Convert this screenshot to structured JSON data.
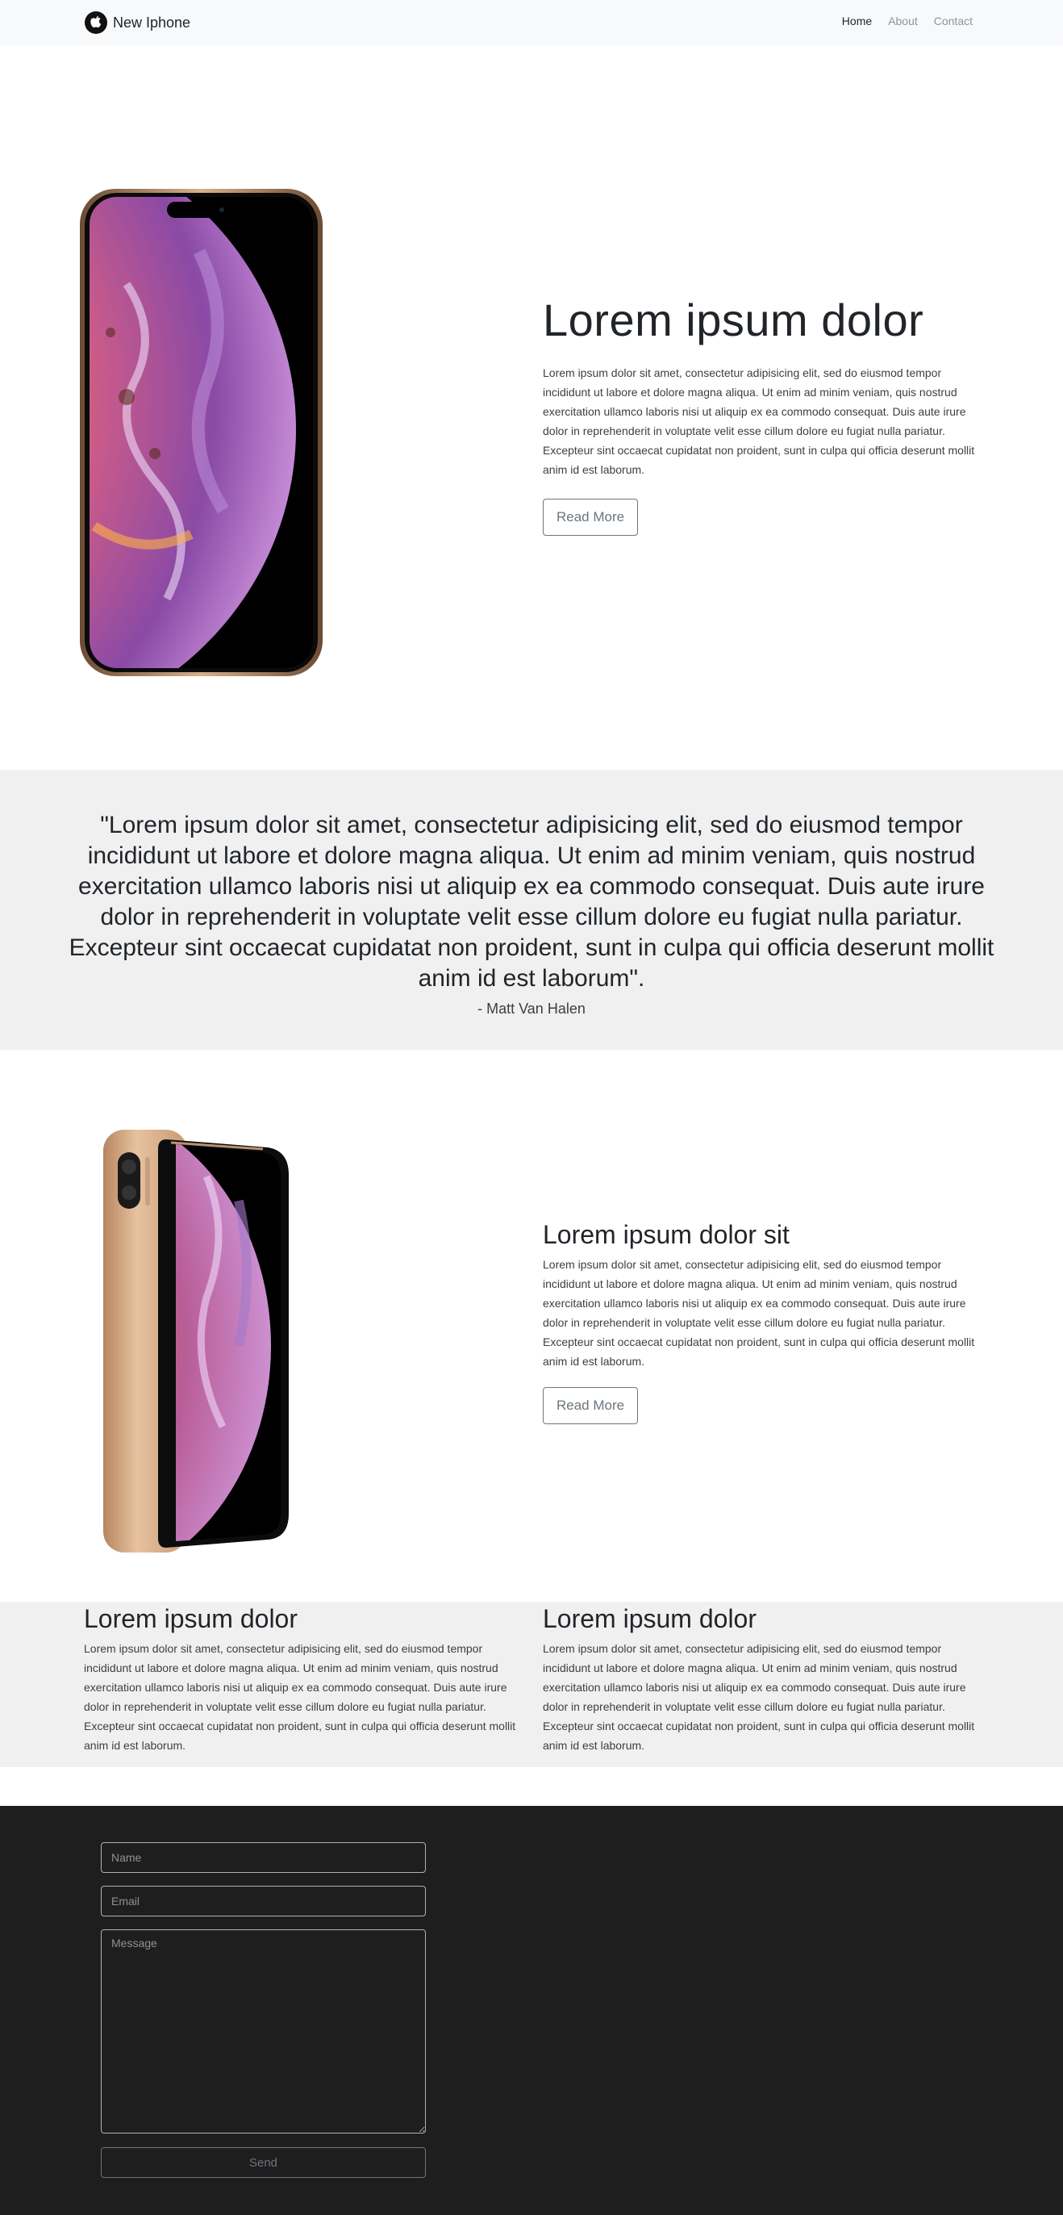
{
  "navbar": {
    "brand": "New Iphone",
    "brand_icon": "apple-logo-icon",
    "links": [
      "Home",
      "About",
      "Contact"
    ],
    "active": "Home"
  },
  "hero": {
    "title": "Lorem ipsum dolor",
    "body": "Lorem ipsum dolor sit amet, consectetur adipisicing elit, sed do eiusmod tempor incididunt ut labore et dolore magna aliqua. Ut enim ad minim veniam, quis nostrud exercitation ullamco laboris nisi ut aliquip ex ea commodo consequat. Duis aute irure dolor in reprehenderit in voluptate velit esse cillum dolore eu fugiat nulla pariatur. Excepteur sint occaecat cupidatat non proident, sunt in culpa qui officia deserunt mollit anim id est laborum.",
    "button": "Read More"
  },
  "quote": {
    "text": "\"Lorem ipsum dolor sit amet, consectetur adipisicing elit, sed do eiusmod tempor incididunt ut labore et dolore magna aliqua. Ut enim ad minim veniam, quis nostrud exercitation ullamco laboris nisi ut aliquip ex ea commodo consequat. Duis aute irure dolor in reprehenderit in voluptate velit esse cillum dolore eu fugiat nulla pariatur. Excepteur sint occaecat cupidatat non proident, sunt in culpa qui officia deserunt mollit anim id est laborum\".",
    "author": "- Matt Van Halen"
  },
  "section2": {
    "title": "Lorem ipsum dolor sit",
    "body": "Lorem ipsum dolor sit amet, consectetur adipisicing elit, sed do eiusmod tempor incididunt ut labore et dolore magna aliqua. Ut enim ad minim veniam, quis nostrud exercitation ullamco laboris nisi ut aliquip ex ea commodo consequat. Duis aute irure dolor in reprehenderit in voluptate velit esse cillum dolore eu fugiat nulla pariatur. Excepteur sint occaecat cupidatat non proident, sunt in culpa qui officia deserunt mollit anim id est laborum.",
    "button": "Read More"
  },
  "columns": [
    {
      "title": "Lorem ipsum dolor",
      "body": "Lorem ipsum dolor sit amet, consectetur adipisicing elit, sed do eiusmod tempor incididunt ut labore et dolore magna aliqua. Ut enim ad minim veniam, quis nostrud exercitation ullamco laboris nisi ut aliquip ex ea commodo consequat. Duis aute irure dolor in reprehenderit in voluptate velit esse cillum dolore eu fugiat nulla pariatur. Excepteur sint occaecat cupidatat non proident, sunt in culpa qui officia deserunt mollit anim id est laborum."
    },
    {
      "title": "Lorem ipsum dolor",
      "body": "Lorem ipsum dolor sit amet, consectetur adipisicing elit, sed do eiusmod tempor incididunt ut labore et dolore magna aliqua. Ut enim ad minim veniam, quis nostrud exercitation ullamco laboris nisi ut aliquip ex ea commodo consequat. Duis aute irure dolor in reprehenderit in voluptate velit esse cillum dolore eu fugiat nulla pariatur. Excepteur sint occaecat cupidatat non proident, sunt in culpa qui officia deserunt mollit anim id est laborum."
    }
  ],
  "form": {
    "name_placeholder": "Name",
    "email_placeholder": "Email",
    "message_placeholder": "Message",
    "send": "Send"
  },
  "colors": {
    "navbar_bg": "#f8f9fa",
    "band_bg": "#f0f0f0",
    "footer_bg": "#1e1e1e",
    "button_outline": "#6c757d"
  }
}
